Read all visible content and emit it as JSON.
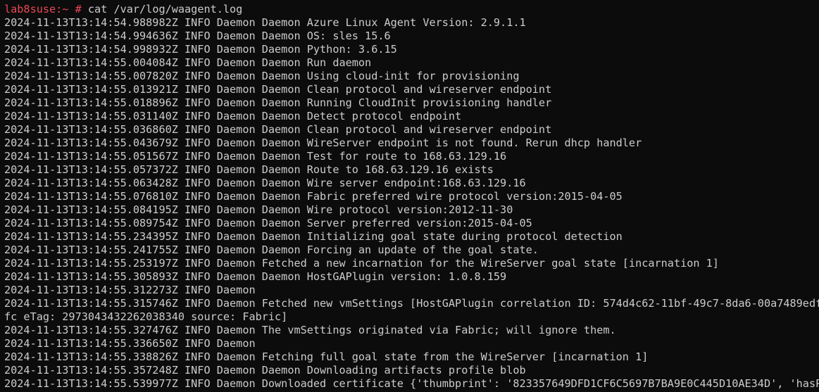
{
  "prompt": {
    "host": "lab8suse:~ #",
    "command": " cat /var/log/waagent.log"
  },
  "lines": [
    "2024-11-13T13:14:54.988982Z INFO Daemon Daemon Azure Linux Agent Version: 2.9.1.1",
    "2024-11-13T13:14:54.994636Z INFO Daemon Daemon OS: sles 15.6",
    "2024-11-13T13:14:54.998932Z INFO Daemon Daemon Python: 3.6.15",
    "2024-11-13T13:14:55.004084Z INFO Daemon Daemon Run daemon",
    "2024-11-13T13:14:55.007820Z INFO Daemon Daemon Using cloud-init for provisioning",
    "2024-11-13T13:14:55.013921Z INFO Daemon Daemon Clean protocol and wireserver endpoint",
    "2024-11-13T13:14:55.018896Z INFO Daemon Daemon Running CloudInit provisioning handler",
    "2024-11-13T13:14:55.031140Z INFO Daemon Daemon Detect protocol endpoint",
    "2024-11-13T13:14:55.036860Z INFO Daemon Daemon Clean protocol and wireserver endpoint",
    "2024-11-13T13:14:55.043679Z INFO Daemon Daemon WireServer endpoint is not found. Rerun dhcp handler",
    "2024-11-13T13:14:55.051567Z INFO Daemon Daemon Test for route to 168.63.129.16",
    "2024-11-13T13:14:55.057372Z INFO Daemon Daemon Route to 168.63.129.16 exists",
    "2024-11-13T13:14:55.063428Z INFO Daemon Daemon Wire server endpoint:168.63.129.16",
    "2024-11-13T13:14:55.076810Z INFO Daemon Daemon Fabric preferred wire protocol version:2015-04-05",
    "2024-11-13T13:14:55.084195Z INFO Daemon Daemon Wire protocol version:2012-11-30",
    "2024-11-13T13:14:55.089754Z INFO Daemon Daemon Server preferred version:2015-04-05",
    "2024-11-13T13:14:55.234395Z INFO Daemon Daemon Initializing goal state during protocol detection",
    "2024-11-13T13:14:55.241755Z INFO Daemon Daemon Forcing an update of the goal state.",
    "2024-11-13T13:14:55.253197Z INFO Daemon Fetched a new incarnation for the WireServer goal state [incarnation 1]",
    "2024-11-13T13:14:55.305893Z INFO Daemon Daemon HostGAPlugin version: 1.0.8.159",
    "2024-11-13T13:14:55.312273Z INFO Daemon",
    "2024-11-13T13:14:55.315746Z INFO Daemon Fetched new vmSettings [HostGAPlugin correlation ID: 574d4c62-11bf-49c7-8da6-00a7489edf",
    "fc eTag: 2973043432262038340 source: Fabric]",
    "2024-11-13T13:14:55.327476Z INFO Daemon The vmSettings originated via Fabric; will ignore them.",
    "2024-11-13T13:14:55.336650Z INFO Daemon",
    "2024-11-13T13:14:55.338826Z INFO Daemon Fetching full goal state from the WireServer [incarnation 1]",
    "2024-11-13T13:14:55.357248Z INFO Daemon Daemon Downloading artifacts profile blob",
    "2024-11-13T13:14:55.539977Z INFO Daemon Downloaded certificate {'thumbprint': '823357649DFD1CF6C5697B7BA9E0C445D10AE34D', 'hasP"
  ],
  "colors": {
    "background": "#0c0c0c",
    "text": "#cccccc",
    "prompt": "#e74856"
  }
}
